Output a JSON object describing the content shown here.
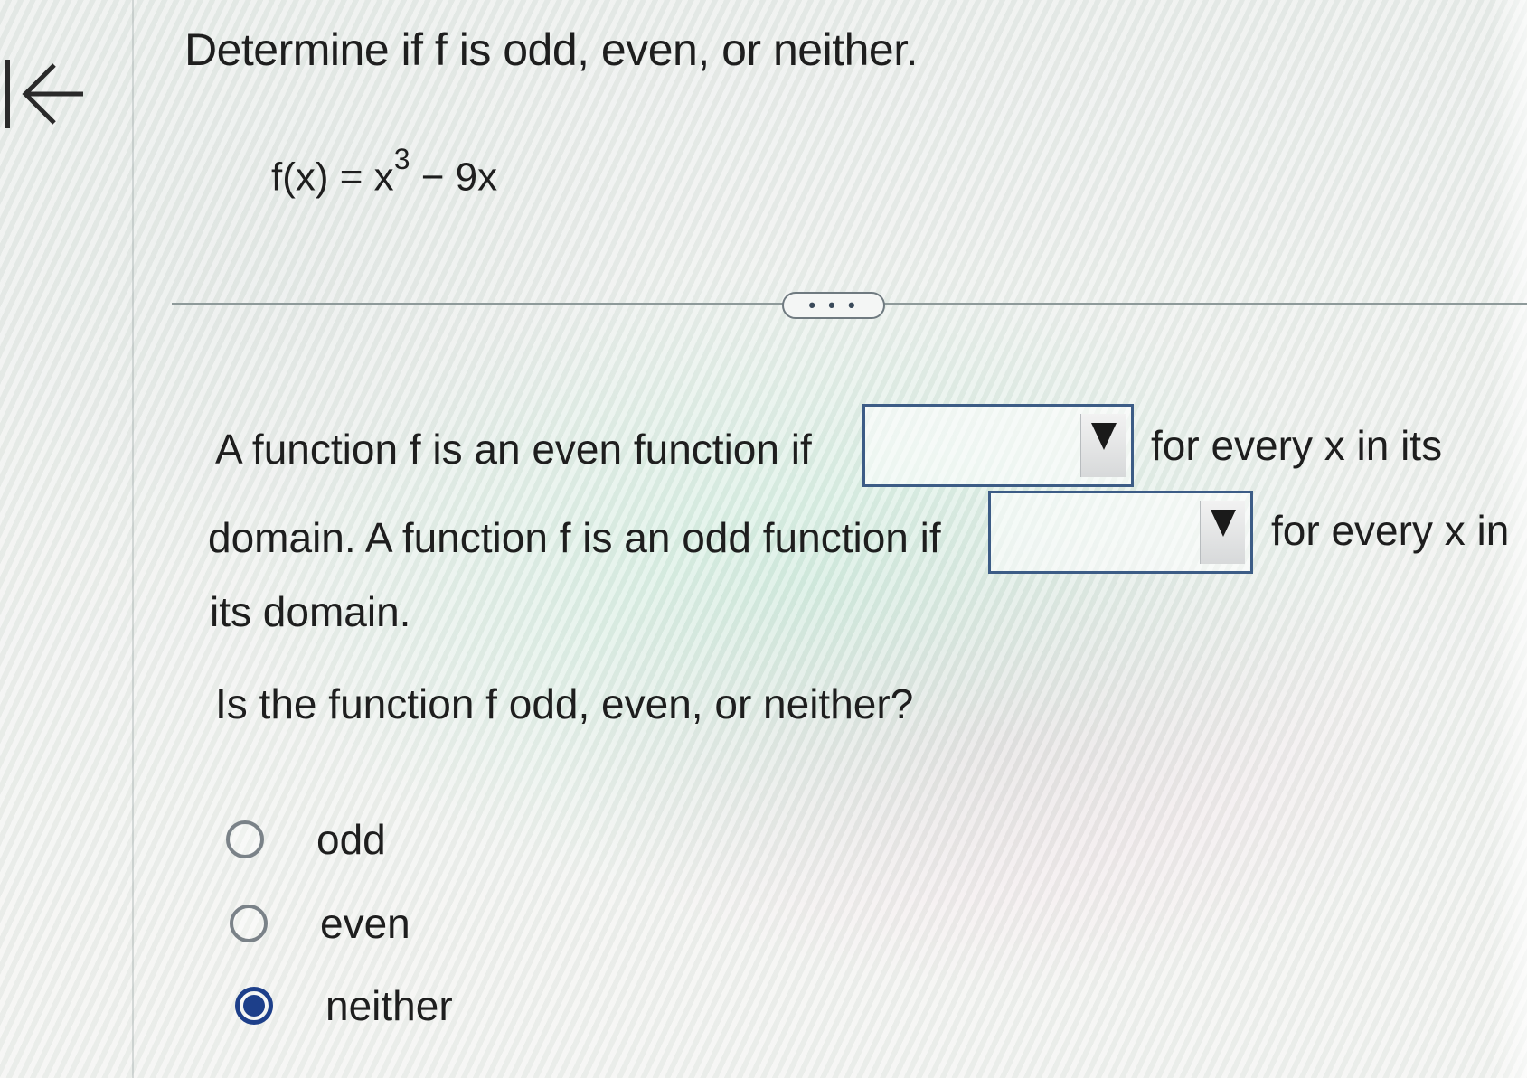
{
  "problem": {
    "title": "Determine if f is odd, even, or neither.",
    "formula_base": "f(x) = x",
    "formula_exponent": "3",
    "formula_tail": " − 9x"
  },
  "more_button_label": "• • •",
  "definition": {
    "line1_before": "A function f is an even function if",
    "line1_after": "for every x in its",
    "line2_before": "domain. A function f is an odd function if",
    "line2_after": "for every x in",
    "line3": "its domain.",
    "dropdown_even_value": "",
    "dropdown_odd_value": ""
  },
  "question": "Is the function f odd, even, or neither?",
  "options": [
    {
      "label": "odd",
      "selected": false
    },
    {
      "label": "even",
      "selected": false
    },
    {
      "label": "neither",
      "selected": true
    }
  ],
  "colors": {
    "selected_radio": "#1d3f8a",
    "dropdown_border": "#3c5c86"
  },
  "icons": {
    "back": "back-to-start-arrow-icon",
    "dropdown": "triangle-down-icon"
  }
}
